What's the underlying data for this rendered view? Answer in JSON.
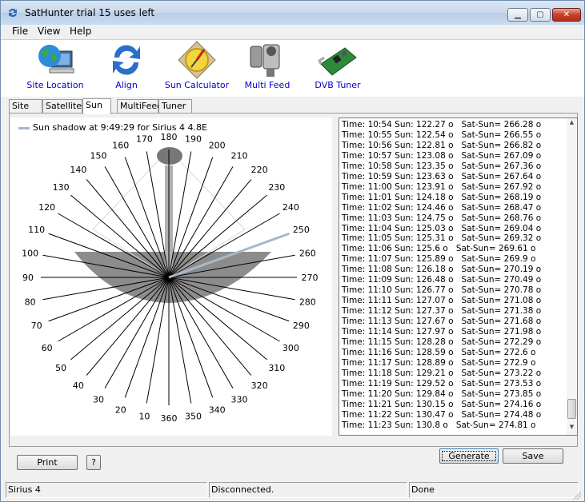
{
  "window": {
    "title": "SatHunter trial 15 uses left",
    "controls": {
      "minimize": "▁",
      "maximize": "▢",
      "close": "✕"
    }
  },
  "menu": [
    "File",
    "View",
    "Help"
  ],
  "toolbar": [
    {
      "label": "Site Location",
      "icon": "globe-computer-icon"
    },
    {
      "label": "Align",
      "icon": "align-arrows-icon"
    },
    {
      "label": "Sun Calculator",
      "icon": "sun-compass-icon"
    },
    {
      "label": "Multi Feed",
      "icon": "lnb-icon"
    },
    {
      "label": "DVB Tuner",
      "icon": "tuner-card-icon"
    }
  ],
  "tabs": [
    "Site",
    "Satellites",
    "Sun",
    "MultiFeed",
    "Tuner"
  ],
  "active_tab": "Sun",
  "chart": {
    "legend": "Sun shadow at 9:49:29 for Sirius 4 4.8E",
    "angles": [
      "360",
      "10",
      "20",
      "30",
      "40",
      "50",
      "60",
      "70",
      "80",
      "90",
      "100",
      "110",
      "120",
      "130",
      "140",
      "150",
      "160",
      "170",
      "180",
      "190",
      "200",
      "210",
      "220",
      "230",
      "240",
      "250",
      "260",
      "270",
      "280",
      "290",
      "300",
      "310",
      "320",
      "330",
      "340",
      "350"
    ],
    "colors": {
      "shadow": "#8c8c8c",
      "line": "#000000",
      "satellite_line": "#a8b8cc",
      "beam": "#b0b0b0"
    }
  },
  "list": [
    "Time: 10:54 Sun: 122.27 o   Sat-Sun= 266.28 o",
    "Time: 10:55 Sun: 122.54 o   Sat-Sun= 266.55 o",
    "Time: 10:56 Sun: 122.81 o   Sat-Sun= 266.82 o",
    "Time: 10:57 Sun: 123.08 o   Sat-Sun= 267.09 o",
    "Time: 10:58 Sun: 123.35 o   Sat-Sun= 267.36 o",
    "Time: 10:59 Sun: 123.63 o   Sat-Sun= 267.64 o",
    "Time: 11:00 Sun: 123.91 o   Sat-Sun= 267.92 o",
    "Time: 11:01 Sun: 124.18 o   Sat-Sun= 268.19 o",
    "Time: 11:02 Sun: 124.46 o   Sat-Sun= 268.47 o",
    "Time: 11:03 Sun: 124.75 o   Sat-Sun= 268.76 o",
    "Time: 11:04 Sun: 125.03 o   Sat-Sun= 269.04 o",
    "Time: 11:05 Sun: 125.31 o   Sat-Sun= 269.32 o",
    "Time: 11:06 Sun: 125.6 o   Sat-Sun= 269.61 o",
    "Time: 11:07 Sun: 125.89 o   Sat-Sun= 269.9 o",
    "Time: 11:08 Sun: 126.18 o   Sat-Sun= 270.19 o",
    "Time: 11:09 Sun: 126.48 o   Sat-Sun= 270.49 o",
    "Time: 11:10 Sun: 126.77 o   Sat-Sun= 270.78 o",
    "Time: 11:11 Sun: 127.07 o   Sat-Sun= 271.08 o",
    "Time: 11:12 Sun: 127.37 o   Sat-Sun= 271.38 o",
    "Time: 11:13 Sun: 127.67 o   Sat-Sun= 271.68 o",
    "Time: 11:14 Sun: 127.97 o   Sat-Sun= 271.98 o",
    "Time: 11:15 Sun: 128.28 o   Sat-Sun= 272.29 o",
    "Time: 11:16 Sun: 128.59 o   Sat-Sun= 272.6 o",
    "Time: 11:17 Sun: 128.89 o   Sat-Sun= 272.9 o",
    "Time: 11:18 Sun: 129.21 o   Sat-Sun= 273.22 o",
    "Time: 11:19 Sun: 129.52 o   Sat-Sun= 273.53 o",
    "Time: 11:20 Sun: 129.84 o   Sat-Sun= 273.85 o",
    "Time: 11:21 Sun: 130.15 o   Sat-Sun= 274.16 o",
    "Time: 11:22 Sun: 130.47 o   Sat-Sun= 274.48 o",
    "Time: 11:23 Sun: 130.8 o   Sat-Sun= 274.81 o"
  ],
  "buttons": {
    "print": "Print",
    "help": "?",
    "generate": "Generate",
    "save": "Save"
  },
  "status": {
    "satellite": "Sirius 4",
    "connection": "Disconnected.",
    "state": "Done"
  }
}
